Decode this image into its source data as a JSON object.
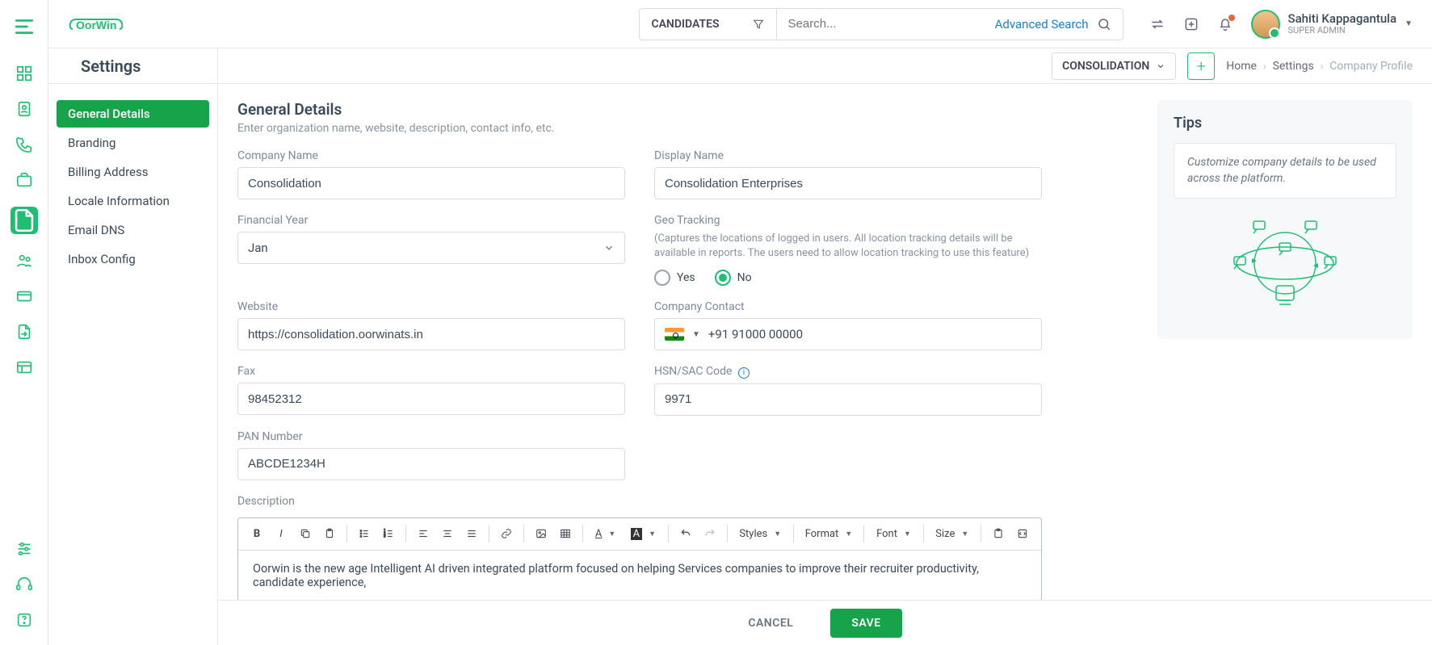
{
  "brand": {
    "logo_text": "OorWin"
  },
  "search": {
    "candidates_label": "CANDIDATES",
    "placeholder": "Search...",
    "advanced": "Advanced Search"
  },
  "user": {
    "name": "Sahiti Kappagantula",
    "role": "SUPER ADMIN"
  },
  "subheader": {
    "title": "Settings",
    "chip": "CONSOLIDATION",
    "breadcrumb": {
      "home": "Home",
      "settings": "Settings",
      "current": "Company Profile"
    }
  },
  "sidebar": {
    "items": [
      "General Details",
      "Branding",
      "Billing Address",
      "Locale Information",
      "Email DNS",
      "Inbox Config"
    ],
    "active_index": 0
  },
  "section": {
    "heading": "General Details",
    "subheading": "Enter organization name, website, description, contact info, etc."
  },
  "form": {
    "company_name": {
      "label": "Company Name",
      "value": "Consolidation"
    },
    "display_name": {
      "label": "Display Name",
      "value": "Consolidation Enterprises"
    },
    "financial_year": {
      "label": "Financial Year",
      "value": "Jan"
    },
    "geo": {
      "label": "Geo Tracking",
      "hint": "(Captures the locations of logged in users. All location tracking details will be available in reports. The users need to allow location tracking to use this feature)",
      "yes": "Yes",
      "no": "No",
      "selected": "no"
    },
    "website": {
      "label": "Website",
      "value": "https://consolidation.oorwinats.in"
    },
    "contact": {
      "label": "Company Contact",
      "value": "+91 91000 00000"
    },
    "fax": {
      "label": "Fax",
      "value": "98452312"
    },
    "hsn": {
      "label": "HSN/SAC Code",
      "value": "9971"
    },
    "pan": {
      "label": "PAN Number",
      "value": "ABCDE1234H"
    },
    "description": {
      "label": "Description",
      "toolbar": {
        "styles": "Styles",
        "format": "Format",
        "font": "Font",
        "size": "Size"
      },
      "value": "Oorwin is the new age Intelligent AI driven integrated platform focused on helping Services companies to improve their recruiter productivity, candidate experience,"
    }
  },
  "tips": {
    "title": "Tips",
    "text": "Customize company details to be used across the platform."
  },
  "actions": {
    "cancel": "CANCEL",
    "save": "SAVE"
  }
}
